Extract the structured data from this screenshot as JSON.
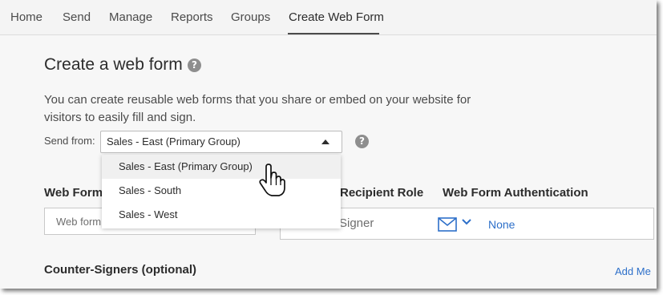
{
  "nav": {
    "items": [
      {
        "label": "Home"
      },
      {
        "label": "Send"
      },
      {
        "label": "Manage"
      },
      {
        "label": "Reports"
      },
      {
        "label": "Groups"
      },
      {
        "label": "Create Web Form"
      }
    ],
    "active": "Create Web Form"
  },
  "page": {
    "title": "Create a web form",
    "help_icon_glyph": "?",
    "description": "You can create reusable web forms that you share or embed on your website for visitors to easily fill and sign."
  },
  "send_from": {
    "label": "Send from:",
    "selected": "Sales - East (Primary Group)",
    "options": [
      {
        "label": "Sales - East (Primary Group)"
      },
      {
        "label": "Sales - South"
      },
      {
        "label": "Sales - West"
      }
    ],
    "help_icon_glyph": "?"
  },
  "form": {
    "name_label": "Web Form",
    "name_input_value": "Web form",
    "recipient_role_label": "Recipient Role",
    "recipient_role_value": "Signer",
    "auth_label": "Web Form Authentication",
    "auth_value": "None"
  },
  "counter_signers": {
    "label": "Counter-Signers (optional)",
    "add_me_label": "Add Me"
  },
  "colors": {
    "link_blue": "#2d6fc9",
    "icon_blue": "#2d6fc9"
  },
  "icons": [
    "help-icon",
    "caret-up-icon",
    "hand-pointer-icon",
    "mail-icon",
    "chevron-down-icon"
  ]
}
